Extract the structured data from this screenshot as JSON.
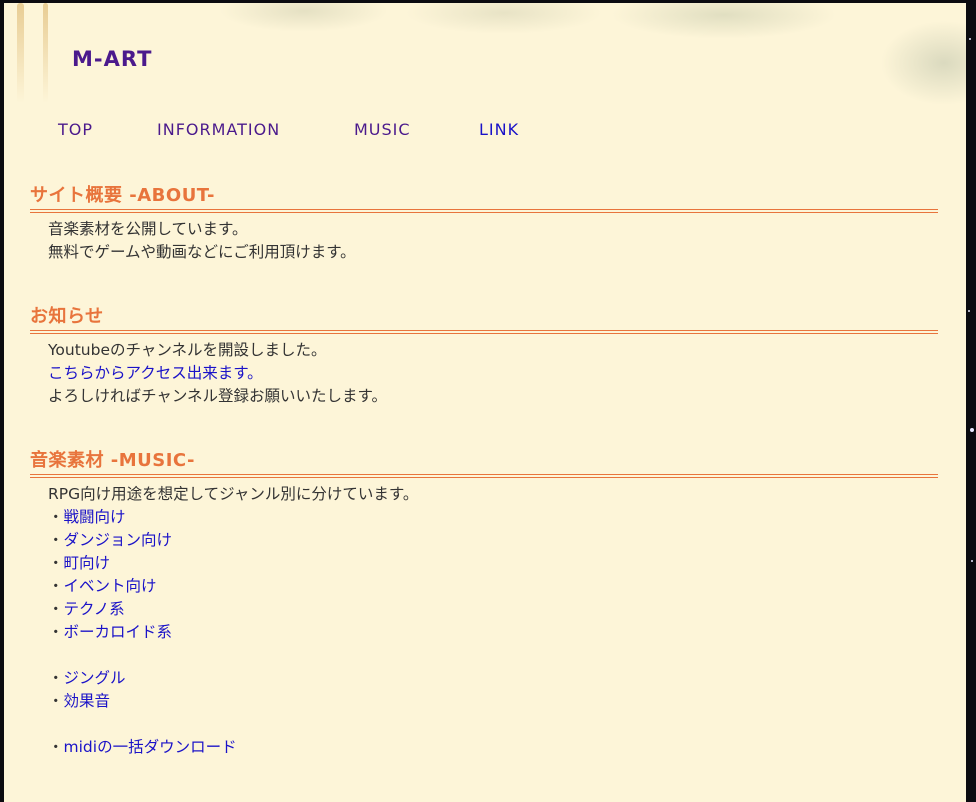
{
  "site": {
    "logo": "M-ART"
  },
  "nav": [
    {
      "label": "TOP",
      "current": false
    },
    {
      "label": "INFORMATION",
      "current": false
    },
    {
      "label": "MUSIC",
      "current": false
    },
    {
      "label": "LINK",
      "current": true
    }
  ],
  "about": {
    "heading": "サイト概要 -ABOUT-",
    "lines": [
      "音楽素材を公開しています。",
      "無料でゲームや動画などにご利用頂けます。"
    ]
  },
  "news": {
    "heading": "お知らせ",
    "line1": "Youtubeのチャンネルを開設しました。",
    "link": "こちらからアクセス出来ます。",
    "line3": "よろしければチャンネル登録お願いいたします。"
  },
  "music": {
    "heading": "音楽素材 -MUSIC-",
    "intro": "RPG向け用途を想定してジャンル別に分けています。",
    "bullet": "・",
    "genres": [
      "戦闘向け",
      "ダンジョン向け",
      "町向け",
      "イベント向け",
      "テクノ系",
      "ボーカロイド系"
    ],
    "extras": [
      "ジングル",
      "効果音"
    ],
    "download": "midiの一括ダウンロード"
  },
  "colors": {
    "page_bg": "#fdf5d8",
    "heading": "#e8743c",
    "logo_nav": "#4b1a8c",
    "link": "#1a12c8"
  }
}
